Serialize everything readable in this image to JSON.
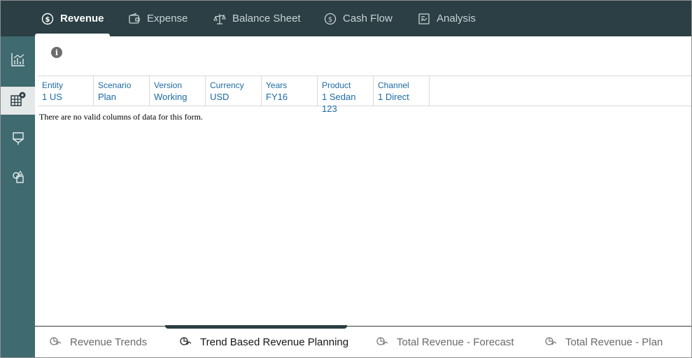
{
  "top_tabs": [
    {
      "label": "Revenue",
      "icon": "dollar-icon",
      "active": true
    },
    {
      "label": "Expense",
      "icon": "wallet-icon",
      "active": false
    },
    {
      "label": "Balance Sheet",
      "icon": "scale-icon",
      "active": false
    },
    {
      "label": "Cash Flow",
      "icon": "dollar-icon",
      "active": false
    },
    {
      "label": "Analysis",
      "icon": "report-icon",
      "active": false
    }
  ],
  "rail": [
    {
      "icon": "chart-icon",
      "active": false
    },
    {
      "icon": "grid-settings-icon",
      "active": true
    },
    {
      "icon": "funnel-icon",
      "active": false
    },
    {
      "icon": "shapes-icon",
      "active": false
    }
  ],
  "pov": [
    {
      "label": "Entity",
      "value": "1 US"
    },
    {
      "label": "Scenario",
      "value": "Plan"
    },
    {
      "label": "Version",
      "value": "Working"
    },
    {
      "label": "Currency",
      "value": "USD"
    },
    {
      "label": "Years",
      "value": "FY16"
    },
    {
      "label": "Product",
      "value": "1 Sedan 123"
    },
    {
      "label": "Channel",
      "value": "1 Direct"
    }
  ],
  "message": "There are no valid columns of data for this form.",
  "bottom_tabs": [
    {
      "label": "Revenue Trends",
      "active": false
    },
    {
      "label": "Trend Based Revenue Planning",
      "active": true
    },
    {
      "label": "Total Revenue - Forecast",
      "active": false
    },
    {
      "label": "Total Revenue - Plan",
      "active": false
    }
  ],
  "colors": {
    "topbar": "#2b3f44",
    "rail": "#3f6a70",
    "link": "#1b6aa5"
  }
}
